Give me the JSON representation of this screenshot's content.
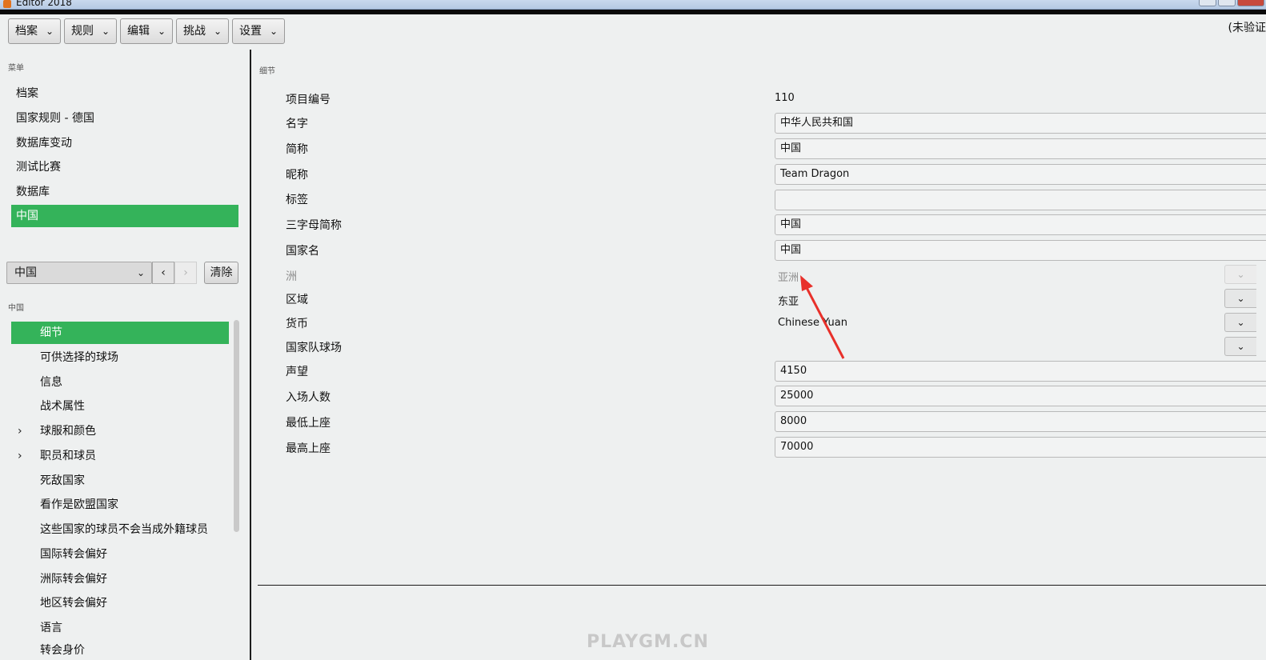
{
  "window": {
    "title": "Editor 2018"
  },
  "toolbar": {
    "menus": [
      {
        "label": "档案"
      },
      {
        "label": "规则"
      },
      {
        "label": "编辑"
      },
      {
        "label": "挑战"
      },
      {
        "label": "设置"
      }
    ],
    "status_text": "(未验证"
  },
  "left": {
    "menu_group_title": "菜单",
    "nav_items": [
      {
        "label": "档案"
      },
      {
        "label": "国家规则 - 德国"
      },
      {
        "label": "数据库变动"
      },
      {
        "label": "测试比赛"
      },
      {
        "label": "数据库"
      },
      {
        "label": "中国",
        "selected": true
      }
    ],
    "selector_value": "中国",
    "clear_label": "清除",
    "sub_group_title": "中国",
    "sub_items": [
      {
        "label": "细节",
        "selected": true
      },
      {
        "label": "可供选择的球场"
      },
      {
        "label": "信息"
      },
      {
        "label": "战术属性"
      },
      {
        "label": "球服和颜色",
        "expandable": true
      },
      {
        "label": "职员和球员",
        "expandable": true
      },
      {
        "label": "死敌国家"
      },
      {
        "label": "看作是欧盟国家"
      },
      {
        "label": "这些国家的球员不会当成外籍球员"
      },
      {
        "label": "国际转会偏好"
      },
      {
        "label": "洲际转会偏好"
      },
      {
        "label": "地区转会偏好"
      },
      {
        "label": "语言"
      },
      {
        "label": "转会身价"
      }
    ]
  },
  "details": {
    "section_title": "细节",
    "fields": {
      "project_id": {
        "label": "项目编号",
        "value": "110"
      },
      "name": {
        "label": "名字",
        "value": "中华人民共和国"
      },
      "short_name": {
        "label": "简称",
        "value": "中国"
      },
      "nickname": {
        "label": "昵称",
        "value": "Team Dragon"
      },
      "tag": {
        "label": "标签",
        "value": ""
      },
      "three_letter": {
        "label": "三字母简称",
        "value": "中国"
      },
      "nation_name": {
        "label": "国家名",
        "value": "中国"
      },
      "continent": {
        "label": "洲",
        "value": "亚洲",
        "disabled": true
      },
      "region": {
        "label": "区域",
        "value": "东亚"
      },
      "currency": {
        "label": "货币",
        "value": "Chinese Yuan"
      },
      "national_stadium": {
        "label": "国家队球场",
        "value": ""
      },
      "reputation": {
        "label": "声望",
        "value": "4150"
      },
      "attendance": {
        "label": "入场人数",
        "value": "25000"
      },
      "min_attendance": {
        "label": "最低上座",
        "value": "8000"
      },
      "max_attendance": {
        "label": "最高上座",
        "value": "70000"
      }
    }
  },
  "annotation": {
    "arrow_color": "#e8302a"
  },
  "watermark": "PLAYGM.CN",
  "colors": {
    "selection_green": "#34b35a",
    "background": "#eef0f0"
  },
  "icons": {
    "dropdown": "chevron-down-icon",
    "prev": "chevron-left-icon",
    "next": "chevron-right-icon",
    "expand": "chevron-right-icon"
  }
}
